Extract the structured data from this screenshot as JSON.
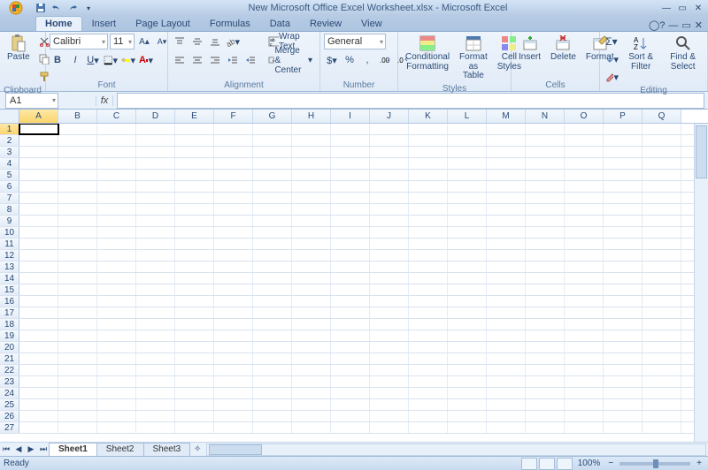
{
  "title": "New Microsoft Office Excel Worksheet.xlsx - Microsoft Excel",
  "tabs": [
    "Home",
    "Insert",
    "Page Layout",
    "Formulas",
    "Data",
    "Review",
    "View"
  ],
  "active_tab": 0,
  "ribbon": {
    "clipboard": {
      "label": "Clipboard",
      "paste": "Paste"
    },
    "font": {
      "label": "Font",
      "name": "Calibri",
      "size": "11"
    },
    "alignment": {
      "label": "Alignment",
      "wrap": "Wrap Text",
      "merge": "Merge & Center"
    },
    "number": {
      "label": "Number",
      "format": "General"
    },
    "styles": {
      "label": "Styles",
      "cond": "Conditional\nFormatting",
      "table": "Format\nas Table",
      "cell": "Cell\nStyles"
    },
    "cells": {
      "label": "Cells",
      "insert": "Insert",
      "delete": "Delete",
      "format": "Format"
    },
    "editing": {
      "label": "Editing",
      "sort": "Sort &\nFilter",
      "find": "Find &\nSelect"
    }
  },
  "namebox": "A1",
  "columns": [
    "A",
    "B",
    "C",
    "D",
    "E",
    "F",
    "G",
    "H",
    "I",
    "J",
    "K",
    "L",
    "M",
    "N",
    "O",
    "P",
    "Q"
  ],
  "rows": 27,
  "active_cell": {
    "row": 1,
    "col": 0
  },
  "sheet_tabs": [
    "Sheet1",
    "Sheet2",
    "Sheet3"
  ],
  "active_sheet": 0,
  "status": {
    "ready": "Ready",
    "zoom": "100%"
  }
}
